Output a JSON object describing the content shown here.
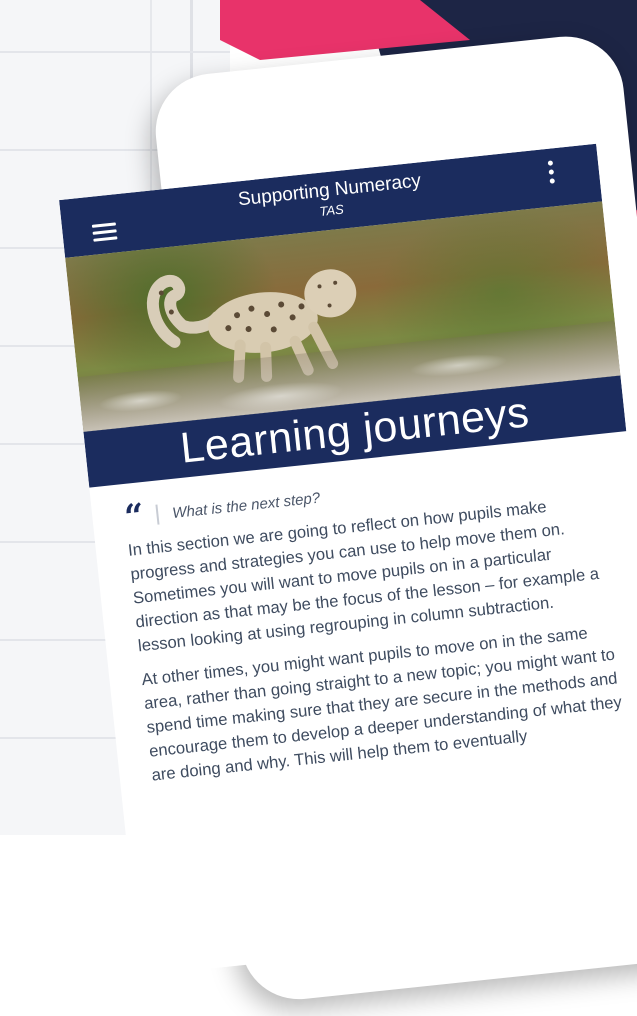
{
  "app_bar": {
    "title": "Supporting Numeracy",
    "subtitle": "TAS",
    "menu_icon": "hamburger-menu-icon",
    "overflow_icon": "more-vertical-icon"
  },
  "hero": {
    "banner_title": "Learning journeys"
  },
  "content": {
    "quote_icon": "quote-icon",
    "quote_text": "What is the next step?",
    "paragraphs": [
      "In this section we are going to reflect on how pupils make progress and strategies you can use to help move them on. Sometimes you will want to move pupils on in a particular direction as that may be the focus of the lesson – for example a lesson looking at using regrouping in column subtraction.",
      "At other times, you might want pupils to move on in the same area, rather than going straight to a new topic; you might want to spend time making sure that they are secure in the methods and encourage them to develop a deeper understanding of what they are doing and why. This will help them to eventually"
    ]
  },
  "colors": {
    "navy": "#1b2c5e",
    "pink": "#e8336a",
    "dark_navy": "#1d2545",
    "body_text": "#3e4b5f"
  }
}
